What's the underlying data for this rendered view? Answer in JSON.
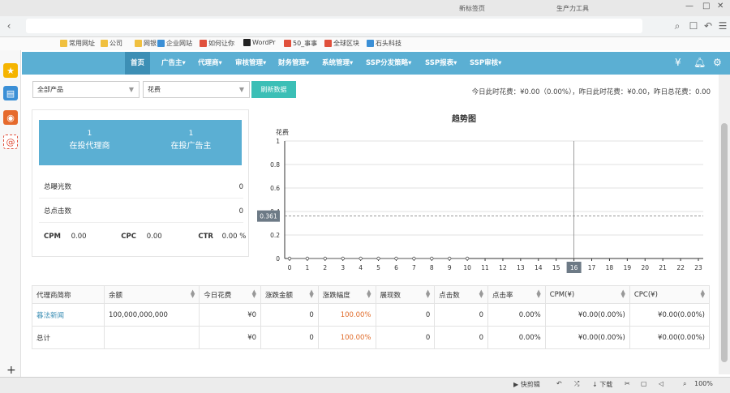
{
  "browser": {
    "tabs": [
      "新标签页",
      "生产力工具"
    ],
    "bookmarks": [
      "常用网址",
      "公司",
      "网银",
      "企业网站",
      "如何让你",
      "WordPr",
      "50_事事",
      "全球区块",
      "石头科技"
    ]
  },
  "nav": {
    "items": [
      {
        "label": "首页",
        "active": true
      },
      {
        "label": "广告主▾"
      },
      {
        "label": "代理商▾"
      },
      {
        "label": "审核管理▾"
      },
      {
        "label": "财务管理▾"
      },
      {
        "label": "系统管理▾"
      },
      {
        "label": "SSP分发策略▾"
      },
      {
        "label": "SSP报表▾"
      },
      {
        "label": "SSP审核▾"
      }
    ],
    "currency_icon": "¥",
    "bell_icon": "bell-icon",
    "gear_icon": "gear-icon"
  },
  "filters": {
    "product_select": "全部产品",
    "metric_select": "花费",
    "refresh_label": "刷新数据",
    "summary": "今日此时花费：¥0.00（0.00%），昨日此时花费：¥0.00，昨日总花费：0.00"
  },
  "stats": {
    "agents_count": "1",
    "agents_label": "在投代理商",
    "advertisers_count": "1",
    "advertisers_label": "在投广告主",
    "impressions_label": "总曝光数",
    "impressions_value": "0",
    "clicks_label": "总点击数",
    "clicks_value": "0",
    "cpm_label": "CPM",
    "cpm_value": "0.00",
    "cpc_label": "CPC",
    "cpc_value": "0.00",
    "ctr_label": "CTR",
    "ctr_value": "0.00 %"
  },
  "chart_data": {
    "type": "line",
    "title": "趋势图",
    "ylabel": "花费",
    "xlabel": "",
    "x": [
      0,
      1,
      2,
      3,
      4,
      5,
      6,
      7,
      8,
      9,
      10,
      11,
      12,
      13,
      14,
      15,
      16,
      17,
      18,
      19,
      20,
      21,
      22,
      23
    ],
    "series": [
      {
        "values": [
          0,
          0,
          0,
          0,
          0,
          0,
          0,
          0,
          0,
          0,
          0
        ]
      }
    ],
    "ylim": [
      0,
      1
    ],
    "yticks": [
      "0",
      "0.2",
      "0.4",
      "0.6",
      "0.8",
      "1"
    ],
    "crosshair_x": 16,
    "crosshair_y": 0.361,
    "crosshair_x_label": "16",
    "crosshair_y_label": "0.361",
    "grid": true
  },
  "table": {
    "headers": [
      "代理商简称",
      "余额",
      "今日花费",
      "涨跌金额",
      "涨跌幅度",
      "展现数",
      "点击数",
      "点击率",
      "CPM(¥)",
      "CPC(¥)"
    ],
    "rows": [
      [
        "暮法新闻",
        "100,000,000,000",
        "¥0",
        "0",
        "100.00%",
        "0",
        "0",
        "0.00%",
        "¥0.00(0.00%)",
        "¥0.00(0.00%)"
      ],
      [
        "总计",
        "",
        "¥0",
        "0",
        "100.00%",
        "0",
        "0",
        "0.00%",
        "¥0.00(0.00%)",
        "¥0.00(0.00%)"
      ]
    ]
  },
  "taskbar": {
    "items": [
      "快剪辑",
      "下载",
      "100%"
    ]
  }
}
